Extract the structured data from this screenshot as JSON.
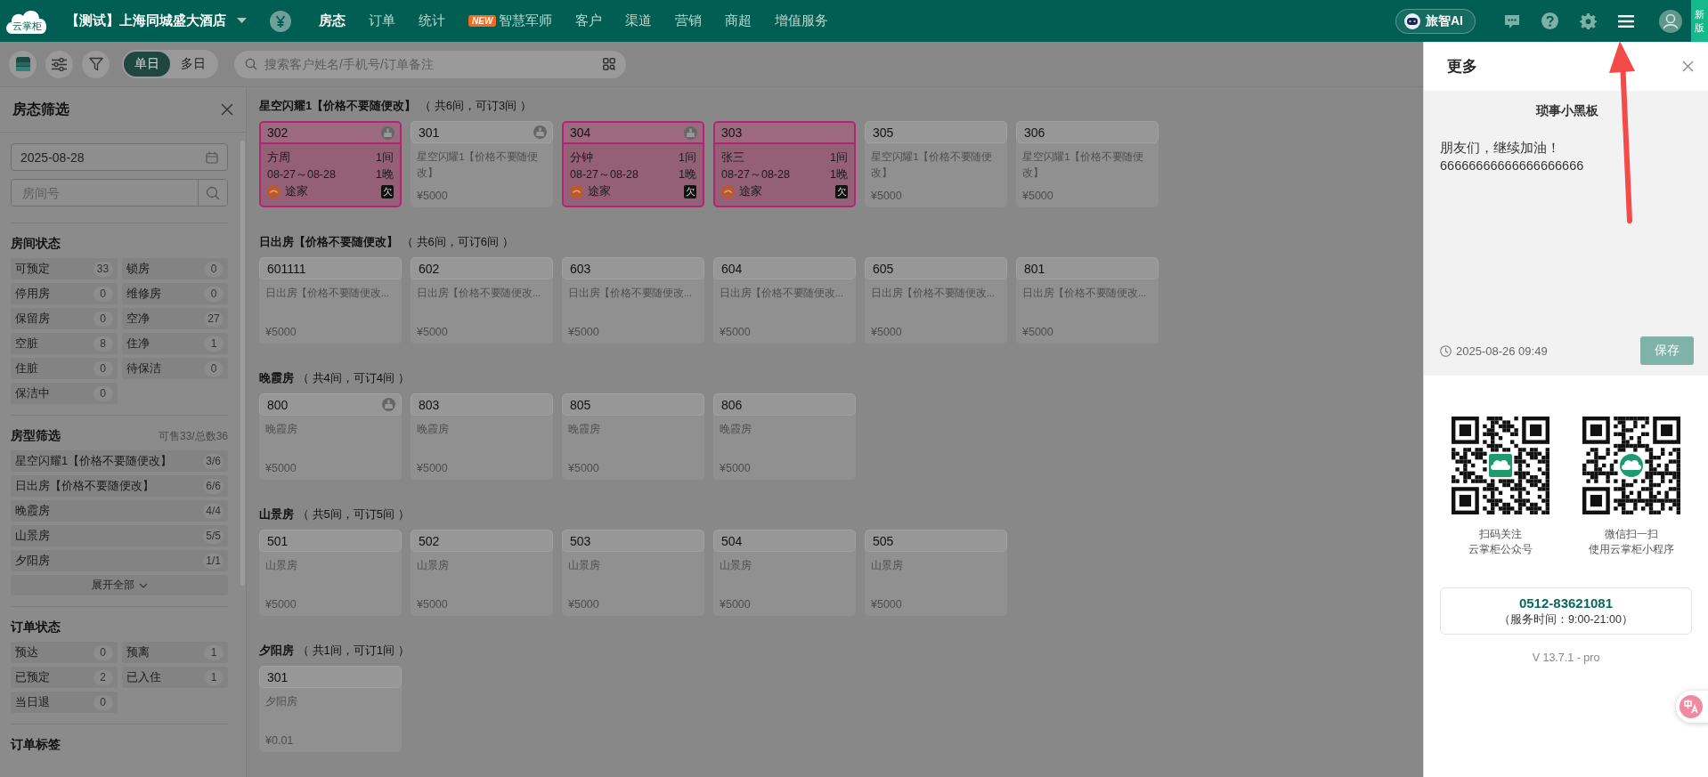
{
  "top_bar": {
    "logo": "云掌柜",
    "hotel": "【测试】上海同城盛大酒店",
    "nav": [
      {
        "label": "房态",
        "selected": true
      },
      {
        "label": "订单",
        "selected": false
      },
      {
        "label": "统计",
        "selected": false
      },
      {
        "label": "智慧军师",
        "badge": "NEW",
        "selected": false
      },
      {
        "label": "客户",
        "selected": false
      },
      {
        "label": "渠道",
        "selected": false
      },
      {
        "label": "营销",
        "selected": false
      },
      {
        "label": "商超",
        "selected": false
      },
      {
        "label": "增值服务",
        "selected": false
      }
    ],
    "ai_button": "旅智AI",
    "new_version_tag": "新版"
  },
  "toolbar": {
    "view_modes": [
      {
        "label": "单日",
        "selected": true
      },
      {
        "label": "多日",
        "selected": false
      }
    ],
    "search": {
      "placeholder": "搜索客户姓名/手机号/订单备注"
    }
  },
  "sidebar": {
    "title": "房态筛选",
    "date": "2025-08-28",
    "room_search": {
      "placeholder": "房间号"
    },
    "sections": [
      {
        "title": "房间状态",
        "kind": "grid",
        "items": [
          {
            "label": "可预定",
            "count": "33"
          },
          {
            "label": "锁房",
            "count": "0"
          },
          {
            "label": "停用房",
            "count": "0"
          },
          {
            "label": "维修房",
            "count": "0"
          },
          {
            "label": "保留房",
            "count": "0"
          },
          {
            "label": "空净",
            "count": "27"
          },
          {
            "label": "空脏",
            "count": "8"
          },
          {
            "label": "住净",
            "count": "1"
          },
          {
            "label": "住脏",
            "count": "0"
          },
          {
            "label": "待保洁",
            "count": "0"
          },
          {
            "label": "保洁中",
            "count": "0"
          }
        ]
      },
      {
        "title": "房型筛选",
        "summary": "可售33/总数36",
        "kind": "list",
        "expand": "展开全部",
        "items": [
          {
            "label": "星空闪耀1【价格不要随便改】",
            "count": "3/6"
          },
          {
            "label": "日出房【价格不要随便改】",
            "count": "6/6"
          },
          {
            "label": "晚霞房",
            "count": "4/4"
          },
          {
            "label": "山景房",
            "count": "5/5"
          },
          {
            "label": "夕阳房",
            "count": "1/1"
          }
        ]
      },
      {
        "title": "订单状态",
        "kind": "grid",
        "items": [
          {
            "label": "预达",
            "count": "0"
          },
          {
            "label": "预离",
            "count": "1"
          },
          {
            "label": "已预定",
            "count": "2"
          },
          {
            "label": "已入住",
            "count": "1"
          },
          {
            "label": "当日退",
            "count": "0"
          }
        ]
      },
      {
        "title": "订单标签",
        "kind": "grid"
      }
    ]
  },
  "room_groups": [
    {
      "title": "星空闪耀1【价格不要随便改】",
      "summary": "（ 共6间，可订3间 ）",
      "rooms": [
        {
          "number": "302",
          "kind": "occupied",
          "dirty": true,
          "guest": "方周",
          "rooms": "1间",
          "dates": "08-27～08-28",
          "nights": "1晚",
          "channel": "途家",
          "badge": "欠"
        },
        {
          "number": "301",
          "kind": "vacant",
          "dirty": true,
          "type": "星空闪耀1【价格不要随便改】",
          "price": "¥5000"
        },
        {
          "number": "304",
          "kind": "occupied",
          "dirty": true,
          "guest": "分钟",
          "rooms": "1间",
          "dates": "08-27～08-28",
          "nights": "1晚",
          "channel": "途家",
          "badge": "欠"
        },
        {
          "number": "303",
          "kind": "occupied",
          "dirty": false,
          "guest": "张三",
          "rooms": "1间",
          "dates": "08-27～08-28",
          "nights": "1晚",
          "channel": "途家",
          "badge": "欠"
        },
        {
          "number": "305",
          "kind": "vacant",
          "dirty": false,
          "type": "星空闪耀1【价格不要随便改】",
          "price": "¥5000"
        },
        {
          "number": "306",
          "kind": "vacant",
          "dirty": false,
          "type": "星空闪耀1【价格不要随便改】",
          "price": "¥5000"
        }
      ]
    },
    {
      "title": "日出房【价格不要随便改】",
      "summary": "（ 共6间，可订6间 ）",
      "rooms": [
        {
          "number": "601111",
          "kind": "vacant",
          "dirty": false,
          "type": "日出房【价格不要随便改...",
          "price": "¥5000"
        },
        {
          "number": "602",
          "kind": "vacant",
          "dirty": false,
          "type": "日出房【价格不要随便改...",
          "price": "¥5000"
        },
        {
          "number": "603",
          "kind": "vacant",
          "dirty": false,
          "type": "日出房【价格不要随便改...",
          "price": "¥5000"
        },
        {
          "number": "604",
          "kind": "vacant",
          "dirty": false,
          "type": "日出房【价格不要随便改...",
          "price": "¥5000"
        },
        {
          "number": "605",
          "kind": "vacant",
          "dirty": false,
          "type": "日出房【价格不要随便改...",
          "price": "¥5000"
        },
        {
          "number": "801",
          "kind": "vacant",
          "dirty": false,
          "type": "日出房【价格不要随便改...",
          "price": "¥5000"
        }
      ]
    },
    {
      "title": "晚霞房",
      "summary": "（ 共4间，可订4间 ）",
      "rooms": [
        {
          "number": "800",
          "kind": "vacant",
          "dirty": true,
          "type": "晚霞房",
          "price": "¥5000"
        },
        {
          "number": "803",
          "kind": "vacant",
          "dirty": false,
          "type": "晚霞房",
          "price": "¥5000"
        },
        {
          "number": "805",
          "kind": "vacant",
          "dirty": false,
          "type": "晚霞房",
          "price": "¥5000"
        },
        {
          "number": "806",
          "kind": "vacant",
          "dirty": false,
          "type": "晚霞房",
          "price": "¥5000"
        }
      ]
    },
    {
      "title": "山景房",
      "summary": "（ 共5间，可订5间 ）",
      "rooms": [
        {
          "number": "501",
          "kind": "vacant",
          "dirty": false,
          "type": "山景房",
          "price": "¥5000"
        },
        {
          "number": "502",
          "kind": "vacant",
          "dirty": false,
          "type": "山景房",
          "price": "¥5000"
        },
        {
          "number": "503",
          "kind": "vacant",
          "dirty": false,
          "type": "山景房",
          "price": "¥5000"
        },
        {
          "number": "504",
          "kind": "vacant",
          "dirty": false,
          "type": "山景房",
          "price": "¥5000"
        },
        {
          "number": "505",
          "kind": "vacant",
          "dirty": false,
          "type": "山景房",
          "price": "¥5000"
        }
      ]
    },
    {
      "title": "夕阳房",
      "summary": "（ 共1间，可订1间 ）",
      "rooms": [
        {
          "number": "301",
          "kind": "vacant",
          "dirty": false,
          "type": "夕阳房",
          "price": "¥0.01"
        }
      ]
    }
  ],
  "more_panel": {
    "title": "更多",
    "blackboard": {
      "title": "琐事小黑板",
      "lines": [
        "朋友们，继续加油！",
        "66666666666666666666"
      ],
      "timestamp": "2025-08-26 09:49",
      "save": {
        "label": "保存",
        "disabled": true
      }
    },
    "qr_codes": [
      {
        "kind": "official_account",
        "caption": [
          "扫码关注",
          "云掌柜公众号"
        ]
      },
      {
        "kind": "mini_program",
        "caption": [
          "微信扫一扫",
          "使用云掌柜小程序"
        ]
      }
    ],
    "phone": "0512-83621081",
    "hours": "（服务时间：9:00-21:00）",
    "version": "V 13.7.1 - pro"
  }
}
